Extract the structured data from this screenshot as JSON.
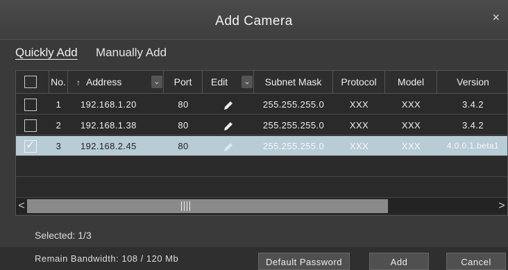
{
  "dialog": {
    "title": "Add Camera",
    "close_glyph": "×"
  },
  "tabs": [
    {
      "label": "Quickly Add"
    },
    {
      "label": "Manually Add"
    }
  ],
  "table": {
    "headers": {
      "no": "No.",
      "address": "Address",
      "port": "Port",
      "edit": "Edit",
      "subnet": "Subnet Mask",
      "protocol": "Protocol",
      "model": "Model",
      "version": "Version"
    },
    "sort_glyph": "↑",
    "dropdown_glyph": "⌄",
    "rows": [
      {
        "no": "1",
        "address": "192.168.1.20",
        "port": "80",
        "subnet": "255.255.255.0",
        "protocol": "XXX",
        "model": "XXX",
        "version": "3.4.2",
        "checked": false
      },
      {
        "no": "2",
        "address": "192.168.1.38",
        "port": "80",
        "subnet": "255.255.255.0",
        "protocol": "XXX",
        "model": "XXX",
        "version": "3.4.2",
        "checked": false
      },
      {
        "no": "3",
        "address": "192.168.2.45",
        "port": "80",
        "subnet": "255.255.255.0",
        "protocol": "XXX",
        "model": "XXX",
        "version": "4.0.0.1.beta1",
        "checked": true
      }
    ],
    "check_glyph": "✓",
    "scroll_left_glyph": "<",
    "scroll_right_glyph": ">"
  },
  "selected_text": "Selected: 1/3",
  "footer": {
    "bandwidth": "Remain Bandwidth: 108 / 120 Mb",
    "default_password": "Default Password",
    "add": "Add",
    "cancel": "Cancel"
  },
  "icons": {
    "edit": "pencil-icon",
    "close": "close-icon"
  },
  "colors": {
    "selected_row": "#b8ccd6",
    "background": "#3a3a3a"
  }
}
